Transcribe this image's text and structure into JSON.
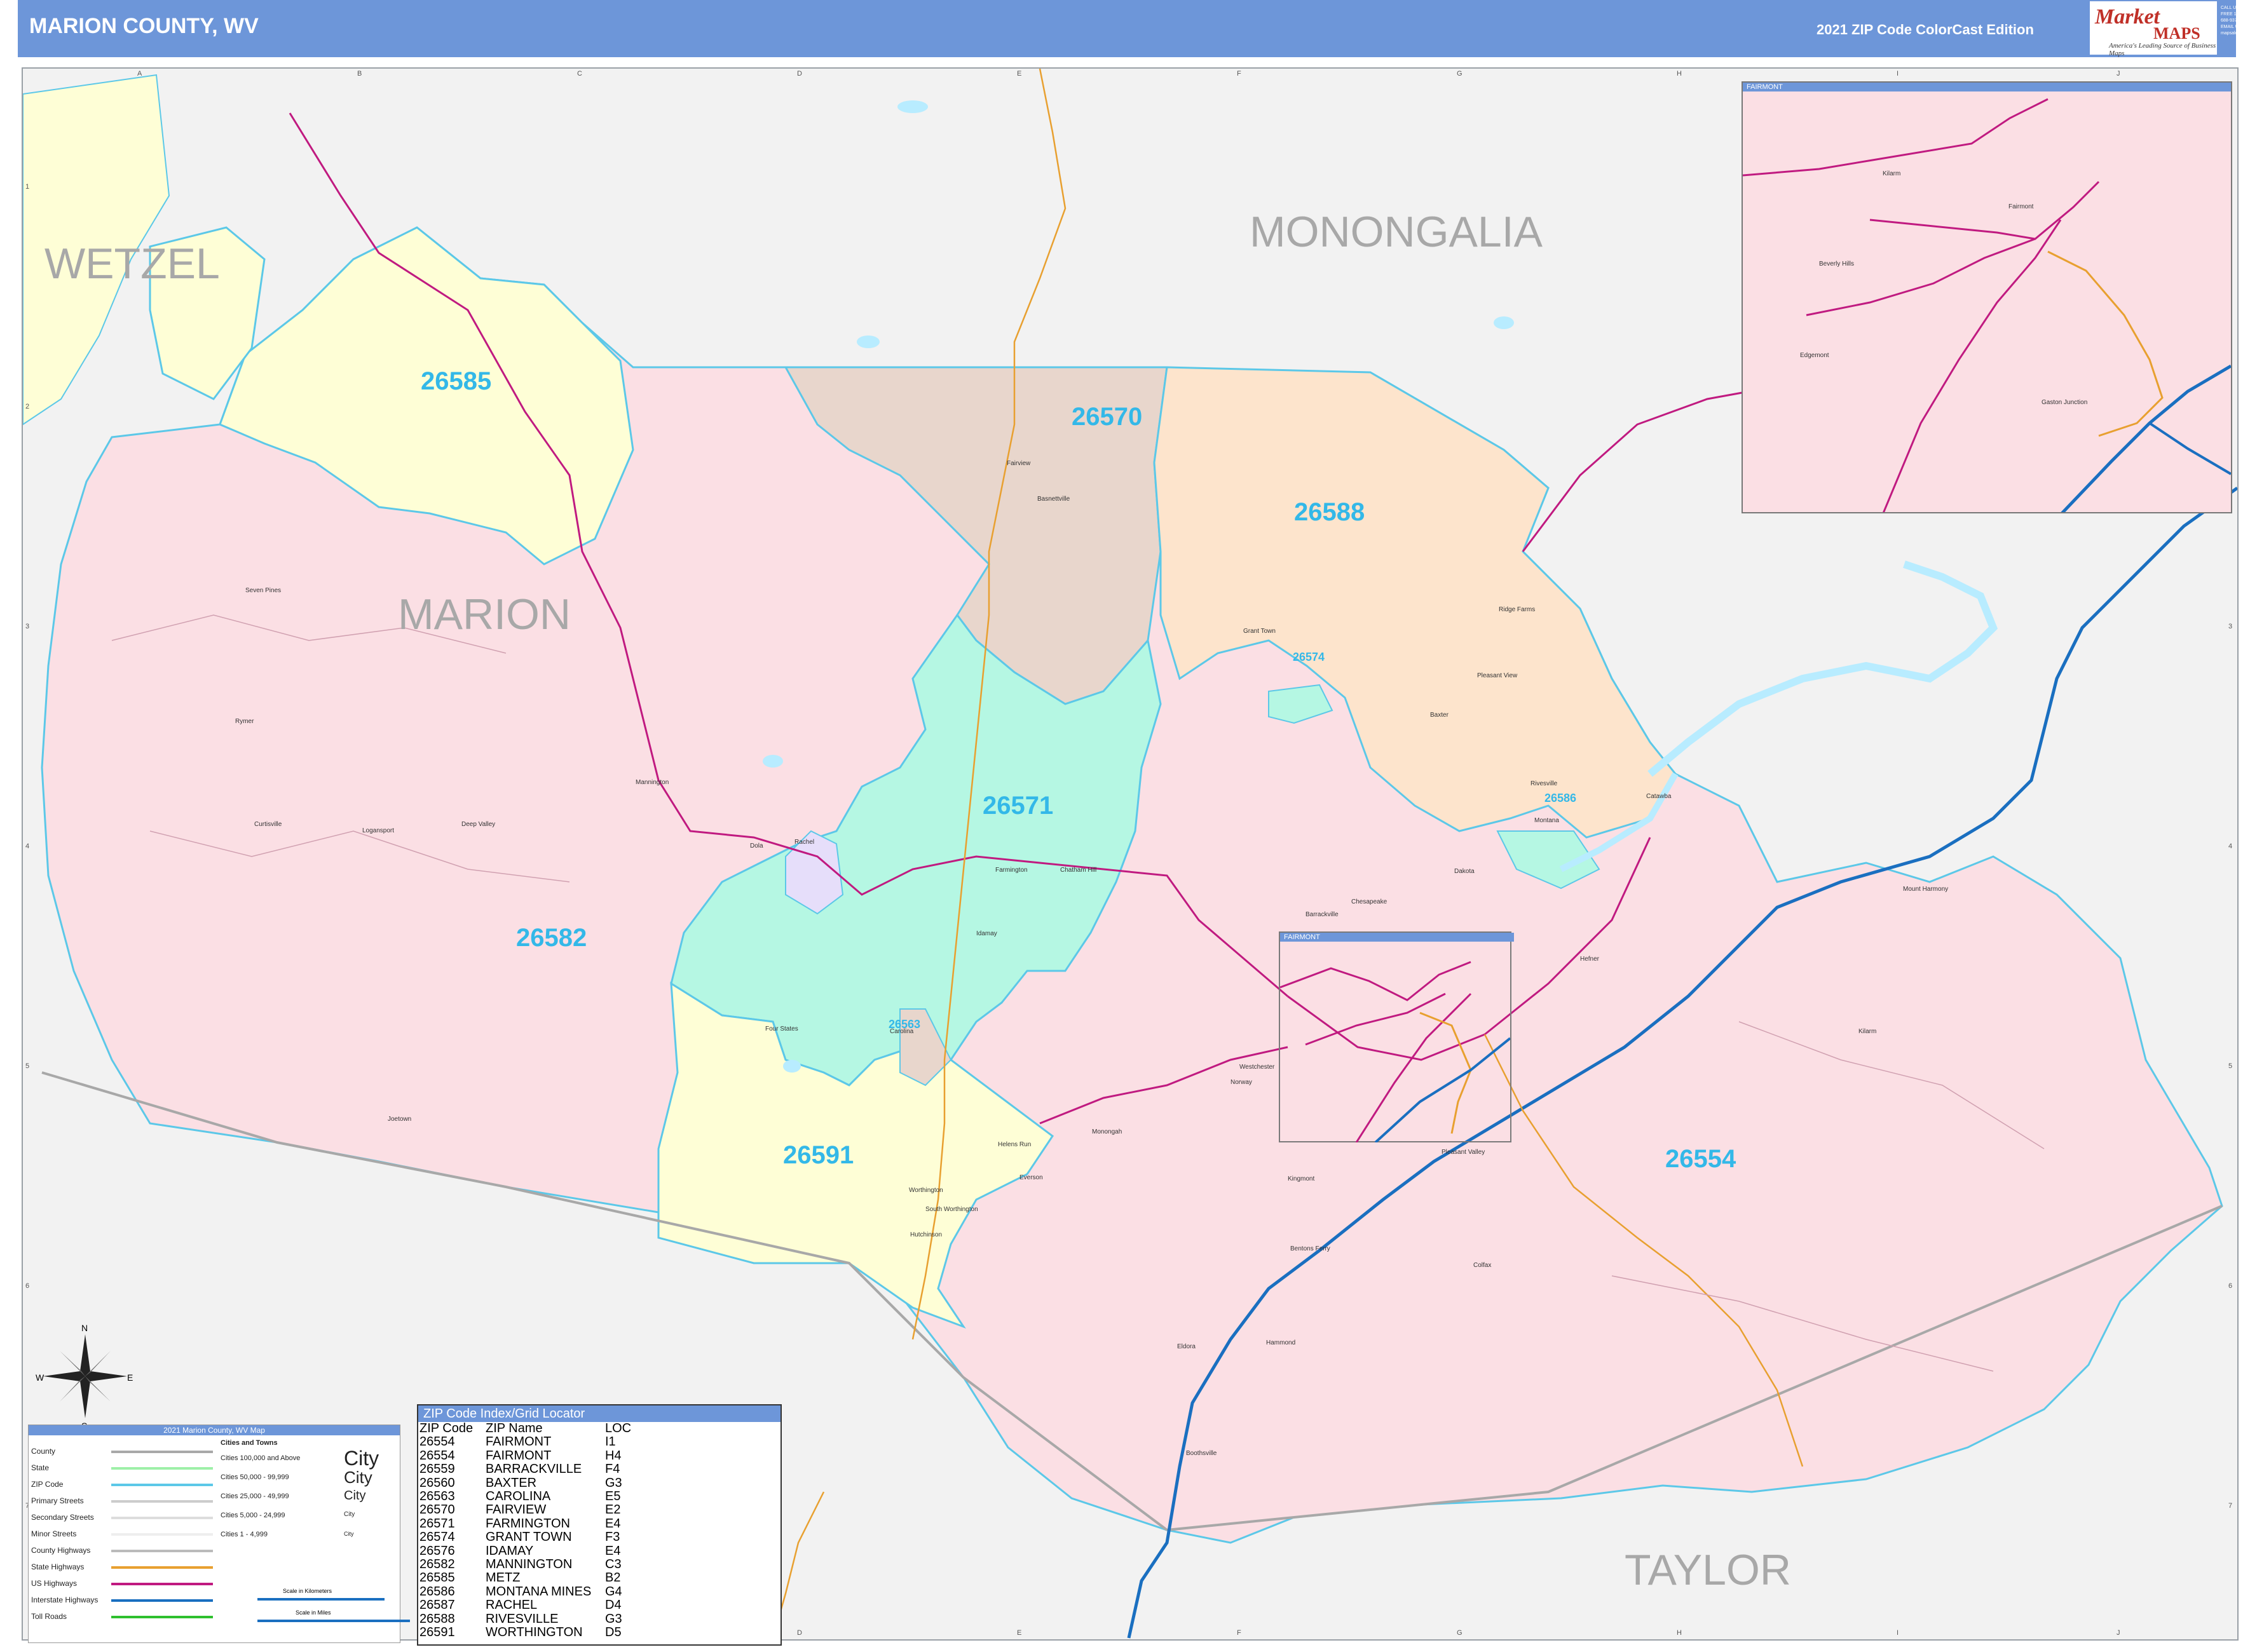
{
  "header": {
    "title": "MARION COUNTY, WV",
    "edition": "2021 ZIP Code ColorCast Edition",
    "logo_line1": "Market",
    "logo_line2": "MAPS",
    "logo_tagline": "America's Leading Source of Business Maps",
    "contact": "CALL US TOLL FREE 1-800-688-9370 EMAIL US AT mapsales@marketmaps.com"
  },
  "counties": {
    "wetzel": "WETZEL",
    "monongalia": "MONONGALIA",
    "marion": "MARION",
    "taylor": "TAYLOR"
  },
  "zips": {
    "z26585": "26585",
    "z26570": "26570",
    "z26588": "26588",
    "z26571": "26571",
    "z26582": "26582",
    "z26591": "26591",
    "z26554": "26554",
    "z26574": "26574",
    "z26586": "26586",
    "z26563": "26563"
  },
  "places": {
    "seven_pines": "Seven Pines",
    "rymer": "Rymer",
    "curtisville": "Curtisville",
    "logansport": "Logansport",
    "deep_valley": "Deep Valley",
    "mannington": "Mannington",
    "dola": "Dola",
    "rachel": "Rachel",
    "fairview": "Fairview",
    "basnettville": "Basnettville",
    "grant_town": "Grant Town",
    "baxter": "Baxter",
    "pleasant_view": "Pleasant View",
    "ridge_farms": "Ridge Farms",
    "rivesville": "Rivesville",
    "montana": "Montana",
    "catawba": "Catawba",
    "farmington": "Farmington",
    "chatham_hill": "Chatham Hill",
    "idamay": "Idamay",
    "carolina": "Carolina",
    "four_states": "Four States",
    "joetown": "Joetown",
    "worthington": "Worthington",
    "south_worthington": "South Worthington",
    "hutchinson": "Hutchinson",
    "helens_run": "Helens Run",
    "monongah": "Monongah",
    "everson": "Everson",
    "norway": "Norway",
    "westchester": "Westchester",
    "barrackville": "Barrackville",
    "chesapeake": "Chesapeake",
    "dakota": "Dakota",
    "mount_harmony": "Mount Harmony",
    "pleasant_valley": "Pleasant Valley",
    "kingmont": "Kingmont",
    "benton_ferry": "Bentons Ferry",
    "colfax": "Colfax",
    "hammond": "Hammond",
    "eldora": "Eldora",
    "boothsville": "Boothsville",
    "hefner": "Hefner",
    "gaston": "Gaston Junction",
    "edgemont": "Edgemont",
    "beverly_hills": "Beverly Hills",
    "fairmont": "Fairmont",
    "kilarm": "Kilarm"
  },
  "inset": {
    "title": "FAIRMONT"
  },
  "locator": {
    "title": "FAIRMONT"
  },
  "grid": {
    "cols": [
      "A",
      "B",
      "C",
      "D",
      "E",
      "F",
      "G",
      "H",
      "I",
      "J"
    ],
    "rows": [
      "1",
      "2",
      "3",
      "4",
      "5",
      "6",
      "7"
    ]
  },
  "zip_index": {
    "title": "ZIP Code Index/Grid Locator",
    "headers": [
      "ZIP Code",
      "ZIP Name",
      "LOC"
    ],
    "rows": [
      [
        "26554",
        "FAIRMONT",
        "I1"
      ],
      [
        "26554",
        "FAIRMONT",
        "H4"
      ],
      [
        "26559",
        "BARRACKVILLE",
        "F4"
      ],
      [
        "26560",
        "BAXTER",
        "G3"
      ],
      [
        "26563",
        "CAROLINA",
        "E5"
      ],
      [
        "26570",
        "FAIRVIEW",
        "E2"
      ],
      [
        "26571",
        "FARMINGTON",
        "E4"
      ],
      [
        "26574",
        "GRANT TOWN",
        "F3"
      ],
      [
        "26576",
        "IDAMAY",
        "E4"
      ],
      [
        "26582",
        "MANNINGTON",
        "C3"
      ],
      [
        "26585",
        "METZ",
        "B2"
      ],
      [
        "26586",
        "MONTANA MINES",
        "G4"
      ],
      [
        "26587",
        "RACHEL",
        "D4"
      ],
      [
        "26588",
        "RIVESVILLE",
        "G3"
      ],
      [
        "26591",
        "WORTHINGTON",
        "D5"
      ]
    ]
  },
  "legend": {
    "title": "2021 Marion County, WV Map",
    "rows": [
      "County",
      "State",
      "ZIP Code",
      "Primary Streets",
      "Secondary Streets",
      "Minor Streets",
      "County Highways",
      "State Highways",
      "US Highways",
      "Interstate Highways",
      "Toll Roads"
    ],
    "city_title": "Cities and Towns",
    "city_rows": [
      "Cities 100,000 and Above",
      "Cities 50,000 - 99,999",
      "Cities 25,000 - 49,999",
      "Cities 5,000 - 24,999",
      "Cities 1 - 4,999"
    ],
    "city_samples": [
      "City",
      "City",
      "City",
      "City",
      "City"
    ],
    "scale_km": "Scale in Kilometers",
    "scale_mi": "Scale in Miles"
  },
  "compass": {
    "n": "N",
    "s": "S",
    "e": "E",
    "w": "W"
  },
  "colors": {
    "header": "#6d96d9",
    "outside": "#f2f2f2",
    "pink": "#fbdfe4",
    "yellow": "#fefed6",
    "tan": "#e8d6cc",
    "peach": "#fde4cc",
    "mint": "#b5f7e3",
    "lavender": "#e6defa",
    "zip_text": "#33b8e8",
    "us_highway": "#c01a80",
    "interstate": "#1a6fc0",
    "state_highway": "#e8a030"
  }
}
